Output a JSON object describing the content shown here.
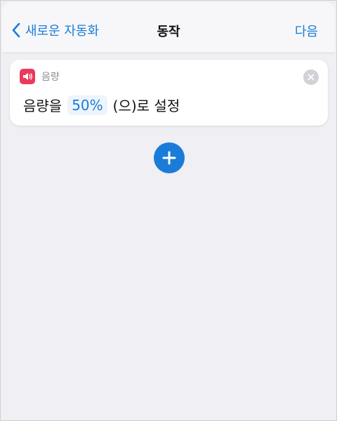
{
  "colors": {
    "accent": "#1a7cd8",
    "volume_icon_bg": "#ea3a5c",
    "background": "#efeff4"
  },
  "nav": {
    "back_label": "새로운 자동화",
    "title": "동작",
    "next_label": "다음"
  },
  "action_card": {
    "icon": "speaker-volume-icon",
    "label": "음량",
    "sentence_prefix": "음량을",
    "value_token": "50%",
    "sentence_suffix": "(으)로 설정"
  },
  "add_button": {
    "icon": "plus-icon"
  }
}
